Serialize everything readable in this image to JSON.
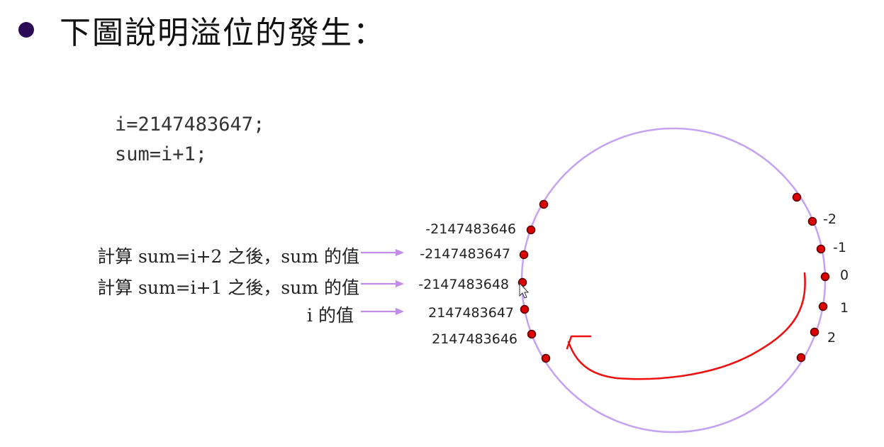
{
  "title": {
    "bullet": "●",
    "text": "下圖說明溢位的發生："
  },
  "code": {
    "line1": "i=2147483647;",
    "line2": "sum=i+1;"
  },
  "annotations": {
    "sum_i_plus_2": "計算 sum=i+2 之後，sum 的值",
    "sum_i_plus_1": "計算 sum=i+1 之後，sum 的值",
    "i_value": "i 的值"
  },
  "circle_labels": {
    "left": [
      "-2147483646",
      "-2147483647",
      "-2147483648",
      "2147483647",
      "2147483646"
    ],
    "right": [
      "-2",
      "-1",
      "0",
      "1",
      "2"
    ]
  },
  "colors": {
    "circle": "#c5a3f2",
    "dot_fill": "#dd0000",
    "dot_stroke": "#550000",
    "pointer_arrow": "#c08ee8",
    "wrap_arrow": "#ee1111",
    "bullet": "#2b0a57"
  },
  "icons": {
    "cursor": "mouse-pointer-icon"
  }
}
